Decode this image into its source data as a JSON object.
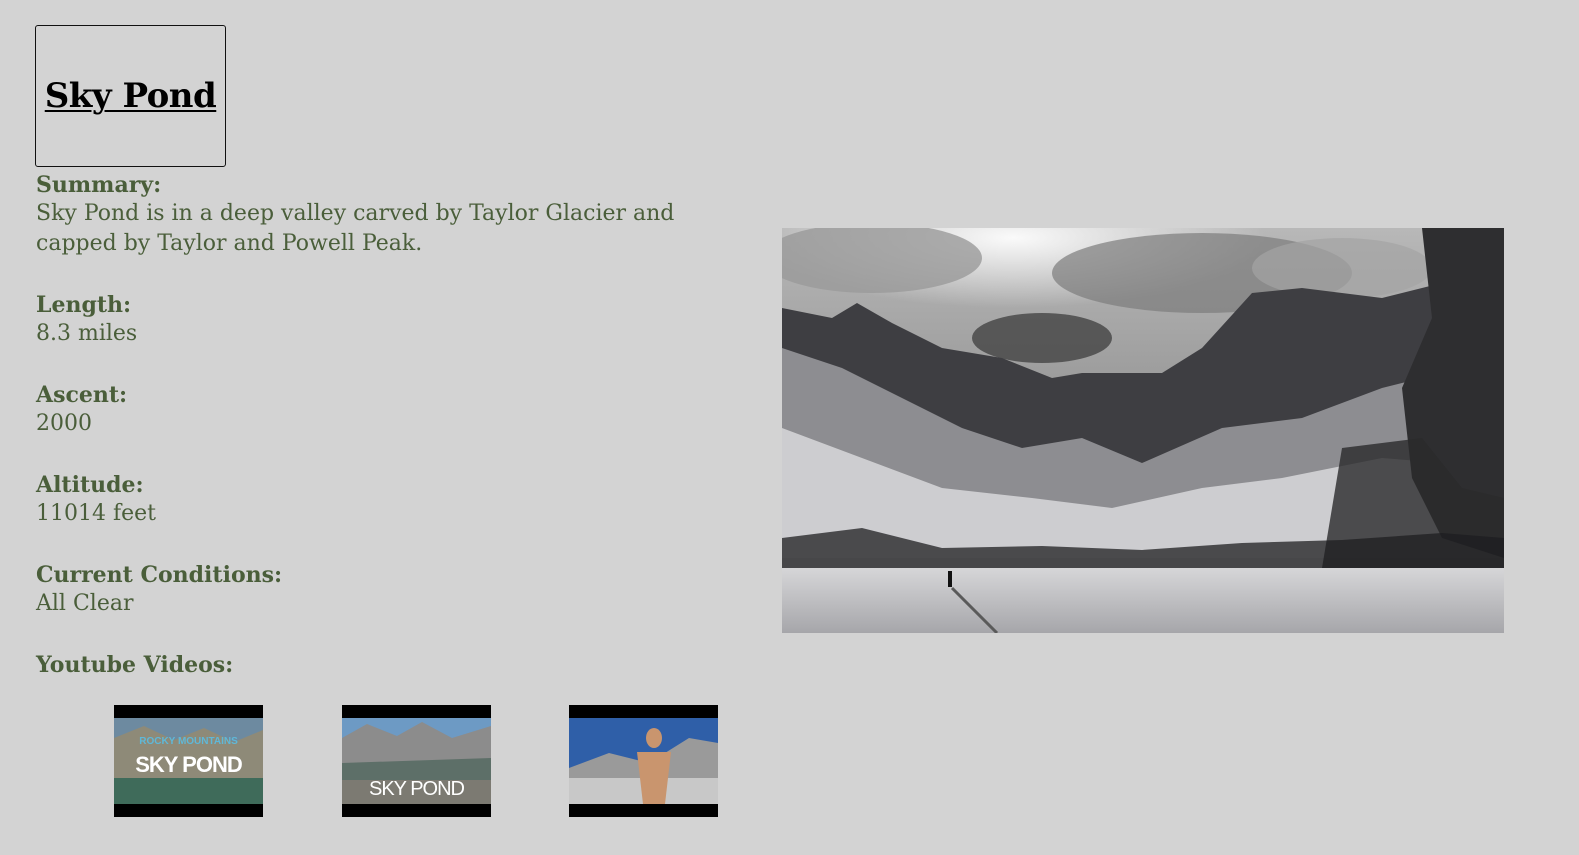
{
  "title": "Sky Pond",
  "details": {
    "summary_label": "Summary:",
    "summary": "Sky Pond is in a deep valley carved by Taylor Glacier and capped by Taylor and Powell Peak.",
    "length_label": "Length:",
    "length": "8.3 miles",
    "ascent_label": "Ascent:",
    "ascent": "2000",
    "altitude_label": "Altitude:",
    "altitude": "11014 feet",
    "conditions_label": "Current Conditions:",
    "conditions": "All Clear",
    "videos_label": "Youtube Videos:"
  },
  "videos": [
    {
      "caption_top": "ROCKY MOUNTAINS",
      "caption": "SKY POND"
    },
    {
      "caption": "SKY POND"
    },
    {
      "caption": ""
    }
  ],
  "colors": {
    "background": "#d3d3d3",
    "text": "#4a5e3a",
    "title": "#000000"
  }
}
